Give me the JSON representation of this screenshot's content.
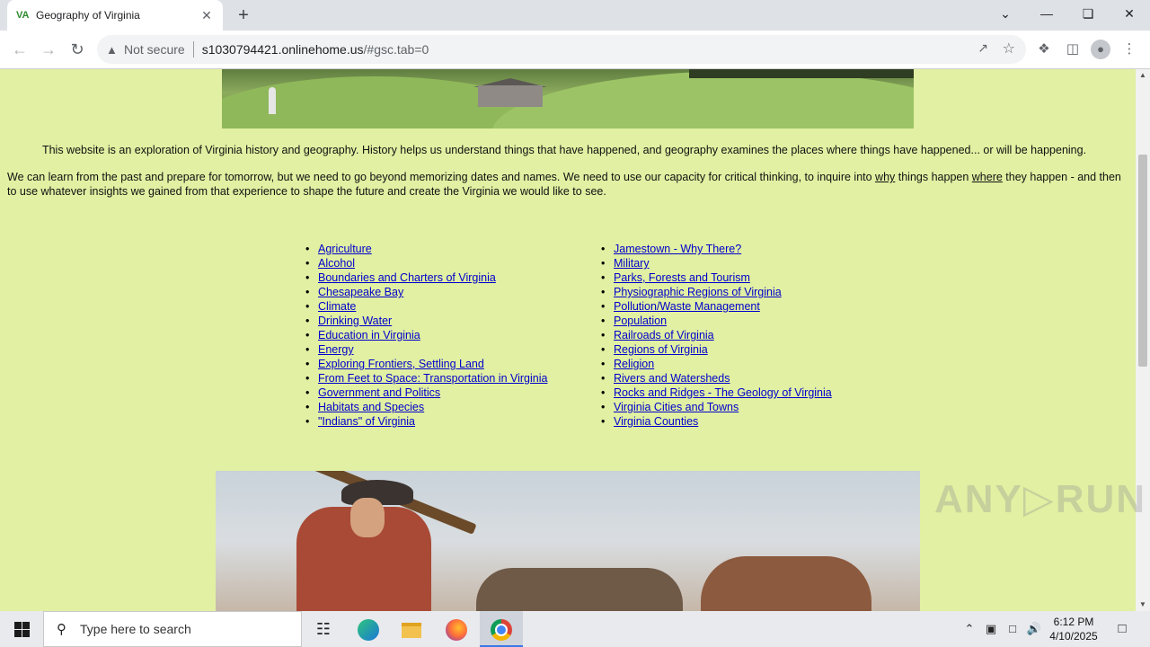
{
  "browser": {
    "tab_favicon": "VA",
    "tab_title": "Geography of Virginia",
    "tab_close": "✕",
    "new_tab": "+",
    "security_label": "Not secure",
    "url_host": "s1030794421.onlinehome.us",
    "url_path": "/#gsc.tab=0"
  },
  "page": {
    "intro": "This website is an exploration of Virginia history and geography. History helps us understand things that have happened, and geography examines the places where things have happened... or will be happening.",
    "intro2_a": "We can learn from the past and prepare for tomorrow, but we need to go beyond memorizing dates and names. We need to use our capacity for critical thinking, to inquire into ",
    "intro2_why": "why",
    "intro2_b": " things happen ",
    "intro2_where": "where",
    "intro2_c": " they happen - and then to use whatever insights we gained from that experience to shape the future and create the Virginia we would like to see.",
    "links_left": [
      "Agriculture",
      "Alcohol",
      "Boundaries and Charters of Virginia",
      "Chesapeake Bay",
      "Climate",
      "Drinking Water",
      "Education in Virginia",
      "Energy",
      "Exploring Frontiers, Settling Land",
      "From Feet to Space: Transportation in Virginia",
      "Government and Politics",
      "Habitats and Species",
      "\"Indians\" of Virginia"
    ],
    "links_right": [
      "Jamestown - Why There?",
      "Military",
      "Parks, Forests and Tourism",
      "Physiographic Regions of Virginia",
      "Pollution/Waste Management",
      "Population",
      "Railroads of Virginia",
      "Regions of Virginia",
      "Religion",
      "Rivers and Watersheds",
      "Rocks and Ridges - The Geology of Virginia",
      "Virginia Cities and Towns",
      "Virginia Counties"
    ],
    "watermark": "ANY▷RUN"
  },
  "taskbar": {
    "search_placeholder": "Type here to search",
    "time": "6:12 PM",
    "date": "4/10/2025"
  },
  "icons": {
    "back": "arrow-left-icon",
    "forward": "arrow-right-icon",
    "reload": "reload-icon",
    "warning": "warning-triangle-icon",
    "share": "share-icon",
    "star": "star-icon",
    "extensions": "puzzle-icon",
    "side_panel": "side-panel-icon",
    "profile": "profile-icon",
    "menu": "kebab-menu-icon"
  },
  "colors": {
    "page_background": "#e1f0a2",
    "link": "#0000cc"
  }
}
